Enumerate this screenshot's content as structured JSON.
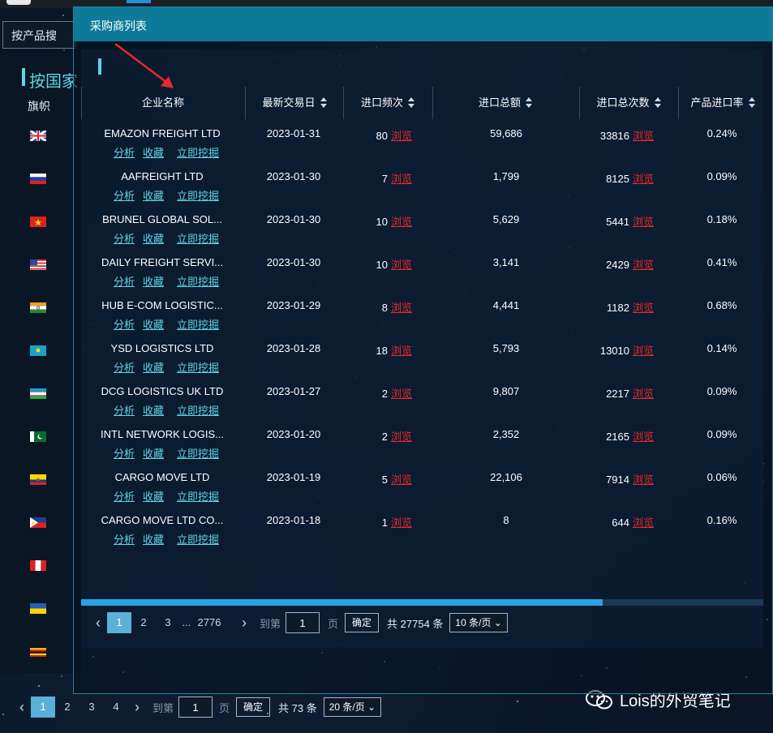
{
  "underlying": {
    "search_mode": "按产品搜",
    "section_title": "按国家",
    "flag_header": "旗帜",
    "flags": [
      "uk-flag-icon",
      "russia-flag-icon",
      "vietnam-flag-icon",
      "usa-flag-icon",
      "india-flag-icon",
      "kazakhstan-flag-icon",
      "uzbekistan-flag-icon",
      "pakistan-flag-icon",
      "ecuador-flag-icon",
      "philippines-flag-icon",
      "peru-flag-icon",
      "ukraine-flag-icon",
      "uganda-flag-icon"
    ],
    "pagination": {
      "pages": [
        "1",
        "2",
        "3",
        "4"
      ],
      "goto_label": "到第",
      "goto_value": "1",
      "page_suffix": "页",
      "confirm": "确定",
      "total": "共 73 条",
      "size": "20 条/页 ⌄"
    }
  },
  "modal": {
    "title": "采购商列表",
    "columns": {
      "company": "企业名称",
      "date": "最新交易日",
      "freq": "进口频次",
      "amount": "进口总额",
      "total": "进口总次数",
      "rate": "产品进口率"
    },
    "action_labels": [
      "分析",
      "收藏",
      "立即挖掘"
    ],
    "browse_label": "浏览",
    "rows": [
      {
        "name": "EMAZON FREIGHT LTD",
        "date": "2023-01-31",
        "freq": "80",
        "amount": "59,686",
        "total": "33816",
        "rate": "0.24%"
      },
      {
        "name": "AAFREIGHT LTD",
        "date": "2023-01-30",
        "freq": "7",
        "amount": "1,799",
        "total": "8125",
        "rate": "0.09%"
      },
      {
        "name": "BRUNEL GLOBAL SOL...",
        "date": "2023-01-30",
        "freq": "10",
        "amount": "5,629",
        "total": "5441",
        "rate": "0.18%"
      },
      {
        "name": "DAILY FREIGHT SERVI...",
        "date": "2023-01-30",
        "freq": "10",
        "amount": "3,141",
        "total": "2429",
        "rate": "0.41%"
      },
      {
        "name": "HUB E-COM LOGISTIC...",
        "date": "2023-01-29",
        "freq": "8",
        "amount": "4,441",
        "total": "1182",
        "rate": "0.68%"
      },
      {
        "name": "YSD LOGISTICS LTD",
        "date": "2023-01-28",
        "freq": "18",
        "amount": "5,793",
        "total": "13010",
        "rate": "0.14%"
      },
      {
        "name": "DCG LOGISTICS UK LTD",
        "date": "2023-01-27",
        "freq": "2",
        "amount": "9,807",
        "total": "2217",
        "rate": "0.09%"
      },
      {
        "name": "INTL NETWORK LOGIS...",
        "date": "2023-01-20",
        "freq": "2",
        "amount": "2,352",
        "total": "2165",
        "rate": "0.09%"
      },
      {
        "name": "CARGO MOVE LTD",
        "date": "2023-01-19",
        "freq": "5",
        "amount": "22,106",
        "total": "7914",
        "rate": "0.06%"
      },
      {
        "name": "CARGO MOVE LTD CO...",
        "date": "2023-01-18",
        "freq": "1",
        "amount": "8",
        "total": "644",
        "rate": "0.16%"
      }
    ],
    "pagination": {
      "pages": [
        "1",
        "2",
        "3",
        "...",
        "2776"
      ],
      "goto_label": "到第",
      "goto_value": "1",
      "page_suffix": "页",
      "confirm": "确定",
      "total": "共 27754 条",
      "size": "10 条/页 ⌄"
    }
  },
  "watermark": "Lois的外贸笔记",
  "colors": {
    "header_bg": "#0e7a9a",
    "accent": "#5fd3e6",
    "link_red": "#e8282b",
    "page_active": "#5ab0d6",
    "annotation_arrow": "#e8282b"
  }
}
